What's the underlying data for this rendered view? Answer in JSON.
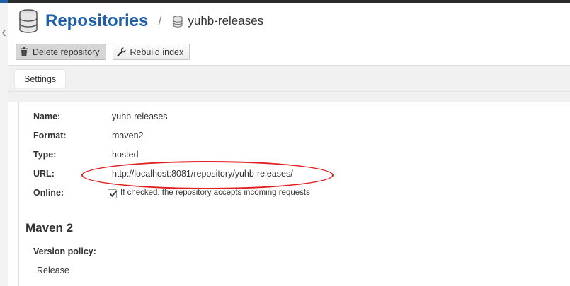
{
  "header": {
    "title": "Repositories",
    "separator": "/",
    "current": "yuhb-releases"
  },
  "toolbar": {
    "delete_label": "Delete repository",
    "rebuild_label": "Rebuild index"
  },
  "tabs": [
    {
      "label": "Settings"
    }
  ],
  "fields": {
    "name": {
      "label": "Name:",
      "value": "yuhb-releases"
    },
    "format": {
      "label": "Format:",
      "value": "maven2"
    },
    "type": {
      "label": "Type:",
      "value": "hosted"
    },
    "url": {
      "label": "URL:",
      "value": "http://localhost:8081/repository/yuhb-releases/"
    },
    "online": {
      "label": "Online:",
      "checkbox_text": "If checked, the repository accepts incoming requests",
      "checked": true
    }
  },
  "maven": {
    "section_title": "Maven 2",
    "version_policy_label": "Version policy:",
    "version_policy_value": "Release"
  },
  "colors": {
    "title": "#1e5fa5",
    "annotation": "#e02020"
  },
  "icons": {
    "title_icon": "database-icon",
    "crumb_icon": "database-icon",
    "delete_icon": "trash-icon",
    "rebuild_icon": "wrench-icon",
    "check_icon": "check-icon"
  }
}
